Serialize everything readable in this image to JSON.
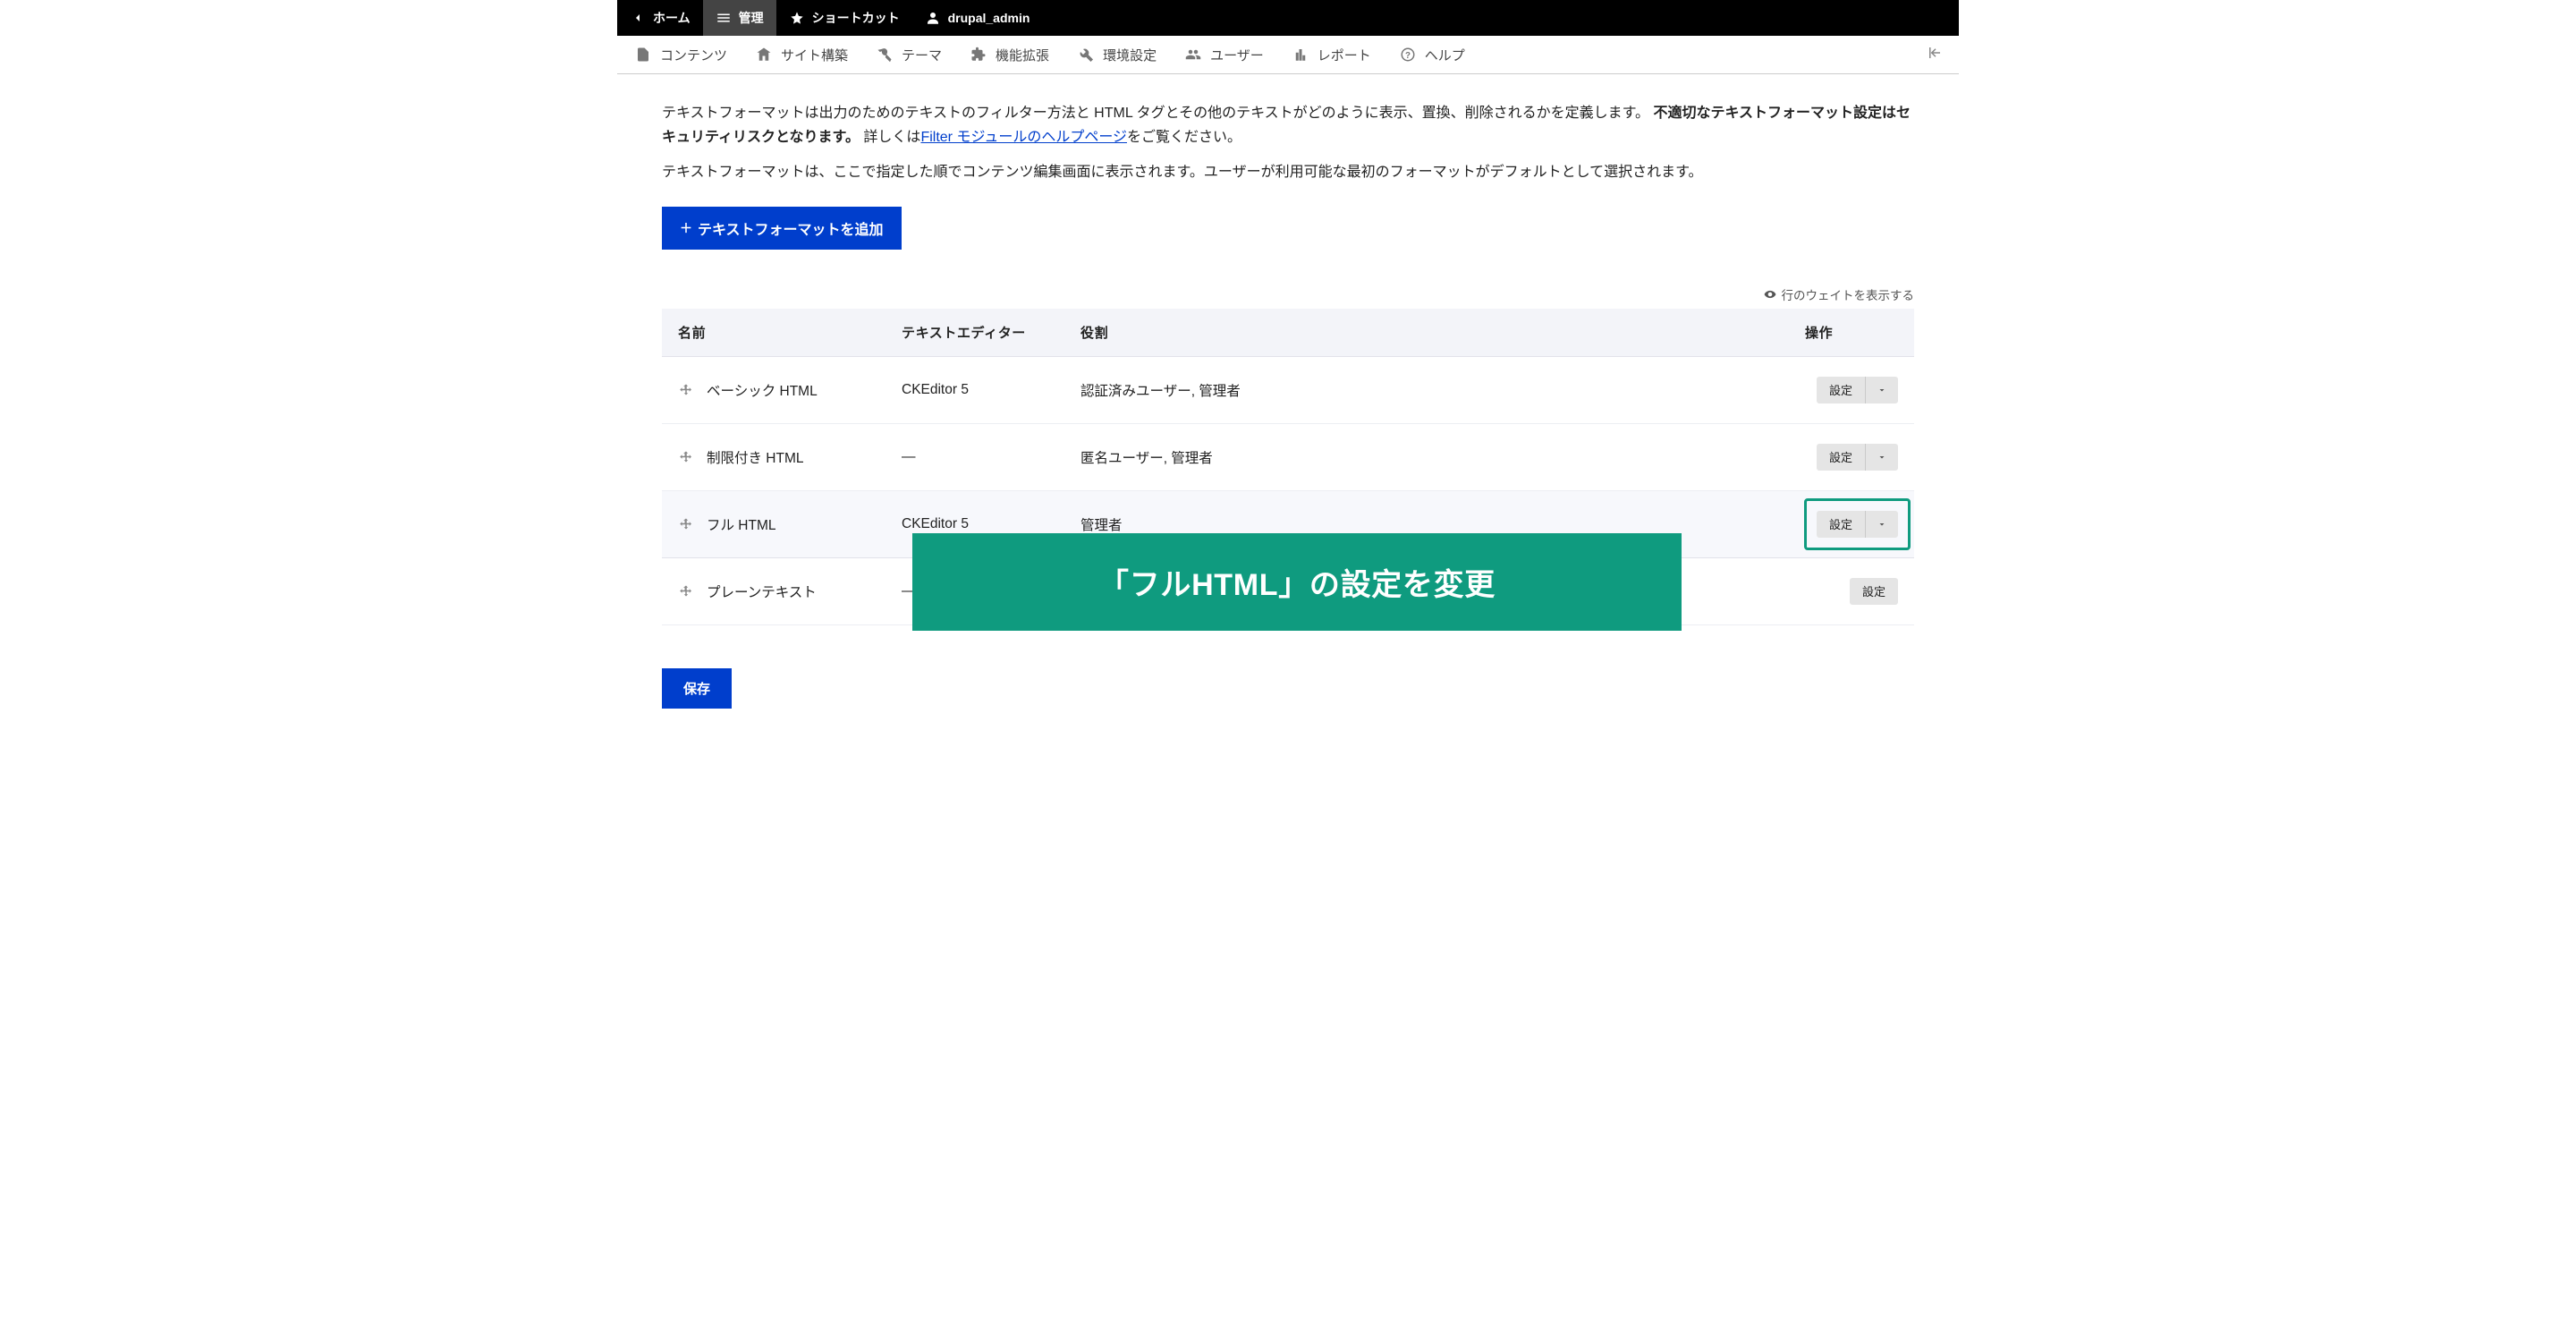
{
  "topbar": {
    "back": "ホーム",
    "manage": "管理",
    "shortcuts": "ショートカット",
    "user": "drupal_admin"
  },
  "adminbar": {
    "content": "コンテンツ",
    "structure": "サイト構築",
    "appearance": "テーマ",
    "extend": "機能拡張",
    "config": "環境設定",
    "people": "ユーザー",
    "reports": "レポート",
    "help": "ヘルプ"
  },
  "help": {
    "p1a": "テキストフォーマットは出力のためのテキストのフィルター方法と HTML タグとその他のテキストがどのように表示、置換、削除されるかを定義します。",
    "p1b": "不適切なテキストフォーマット設定はセキュリティリスクとなります。",
    "p1c": "詳しくは",
    "p1link": "Filter モジュールのヘルプページ",
    "p1d": "をご覧ください。",
    "p2": "テキストフォーマットは、ここで指定した順でコンテンツ編集画面に表示されます。ユーザーが利用可能な最初のフォーマットがデフォルトとして選択されます。"
  },
  "addButton": "テキストフォーマットを追加",
  "toggleWeights": "行のウェイトを表示する",
  "table": {
    "headers": {
      "name": "名前",
      "editor": "テキストエディター",
      "roles": "役割",
      "ops": "操作"
    },
    "rows": [
      {
        "name": "ベーシック HTML",
        "editor": "CKEditor 5",
        "roles": "認証済みユーザー, 管理者",
        "op": "設定",
        "hasDrop": true,
        "highlighted": false
      },
      {
        "name": "制限付き HTML",
        "editor": "—",
        "roles": "匿名ユーザー, 管理者",
        "op": "設定",
        "hasDrop": true,
        "highlighted": false
      },
      {
        "name": "フル HTML",
        "editor": "CKEditor 5",
        "roles": "管理者",
        "op": "設定",
        "hasDrop": true,
        "highlighted": true
      },
      {
        "name": "プレーンテキスト",
        "editor": "—",
        "roles": "",
        "op": "設定",
        "hasDrop": false,
        "highlighted": false
      }
    ]
  },
  "annotation": "「フルHTML」の設定を変更",
  "saveButton": "保存"
}
